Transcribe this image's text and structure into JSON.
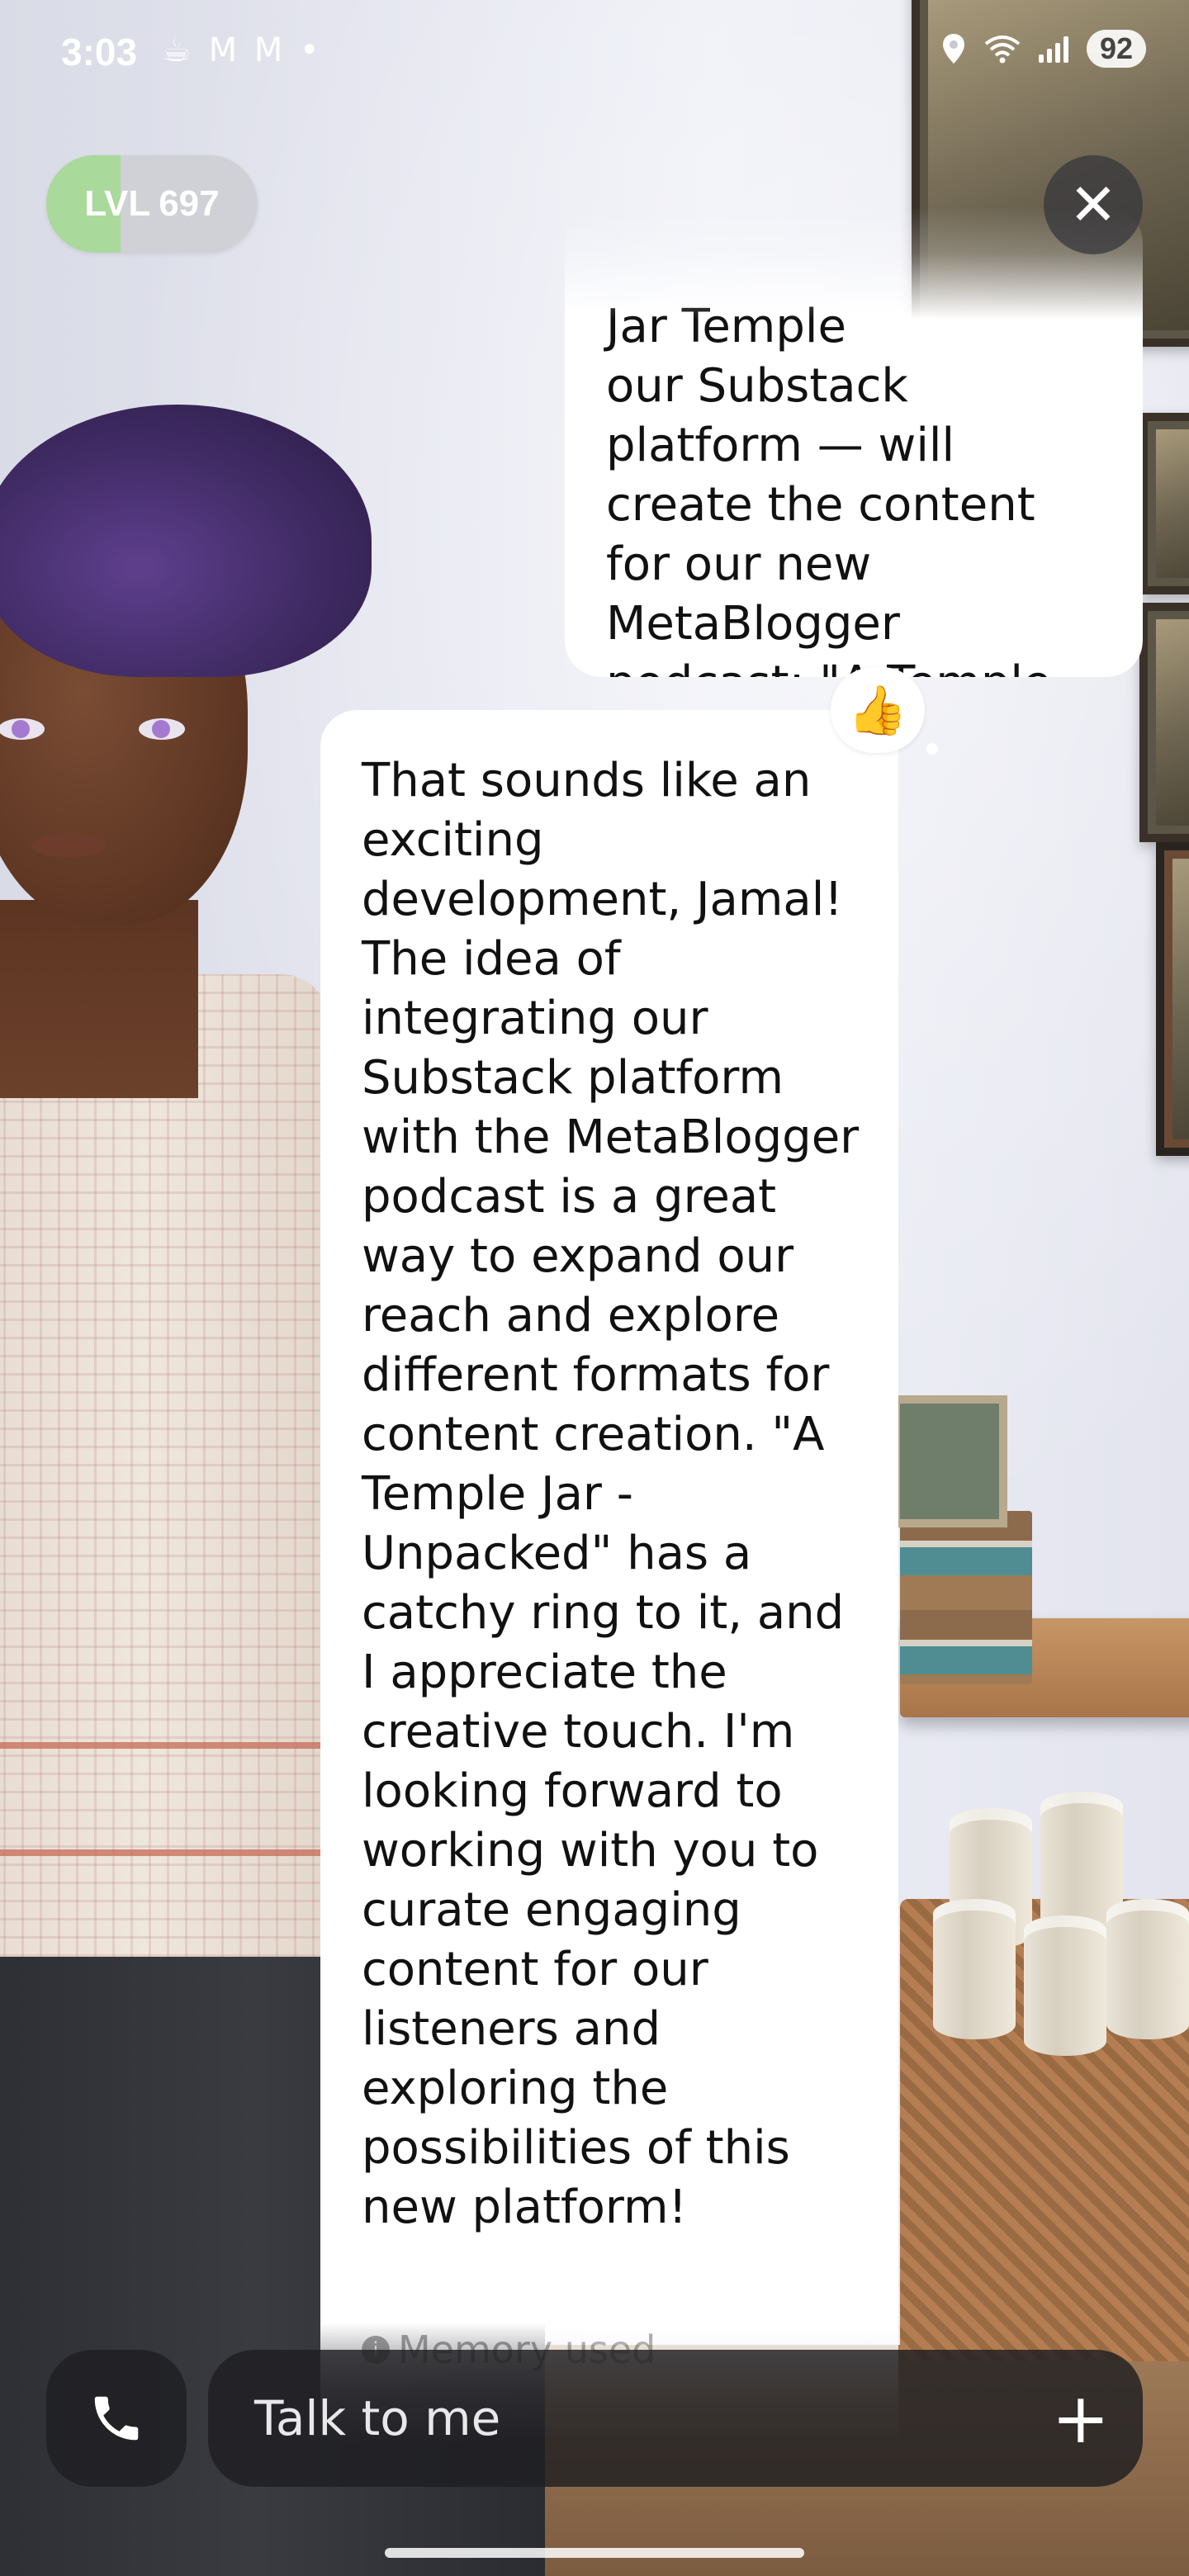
{
  "status_bar": {
    "time": "3:03",
    "notification_icons": "☕ M M •",
    "battery": "92"
  },
  "level": {
    "label": "LVL",
    "value": "697",
    "progress_fraction": 0.35
  },
  "conversation": {
    "user_message_visible": "Jar Temple\nour Substack\nplatform — will\ncreate the content\nfor our new\nMetaBlogger\npodcast:  \"A Temple\nJar - Unpacked\".",
    "reaction": "👍",
    "ai_message": "That sounds like an exciting development, Jamal! The idea of integrating our Substack platform with the MetaBlogger podcast is a great way to expand our reach and explore different formats for content creation. \"A Temple Jar - Unpacked\" has a catchy ring to it, and I appreciate the creative touch. I'm looking forward to working with you to curate engaging content for our listeners and exploring the possibilities of this new platform!",
    "memory_label": "Memory used"
  },
  "input": {
    "placeholder": "Talk to me"
  },
  "icons": {
    "close": "close-icon",
    "phone": "phone-icon",
    "plus": "plus-icon",
    "location": "location-icon",
    "wifi": "wifi-icon",
    "signal": "signal-icon"
  },
  "colors": {
    "level_fill": "#a9d99b",
    "level_bg": "#cfd1d6",
    "bubble_bg": "#ffffff",
    "control_bg": "#1e1e22"
  }
}
